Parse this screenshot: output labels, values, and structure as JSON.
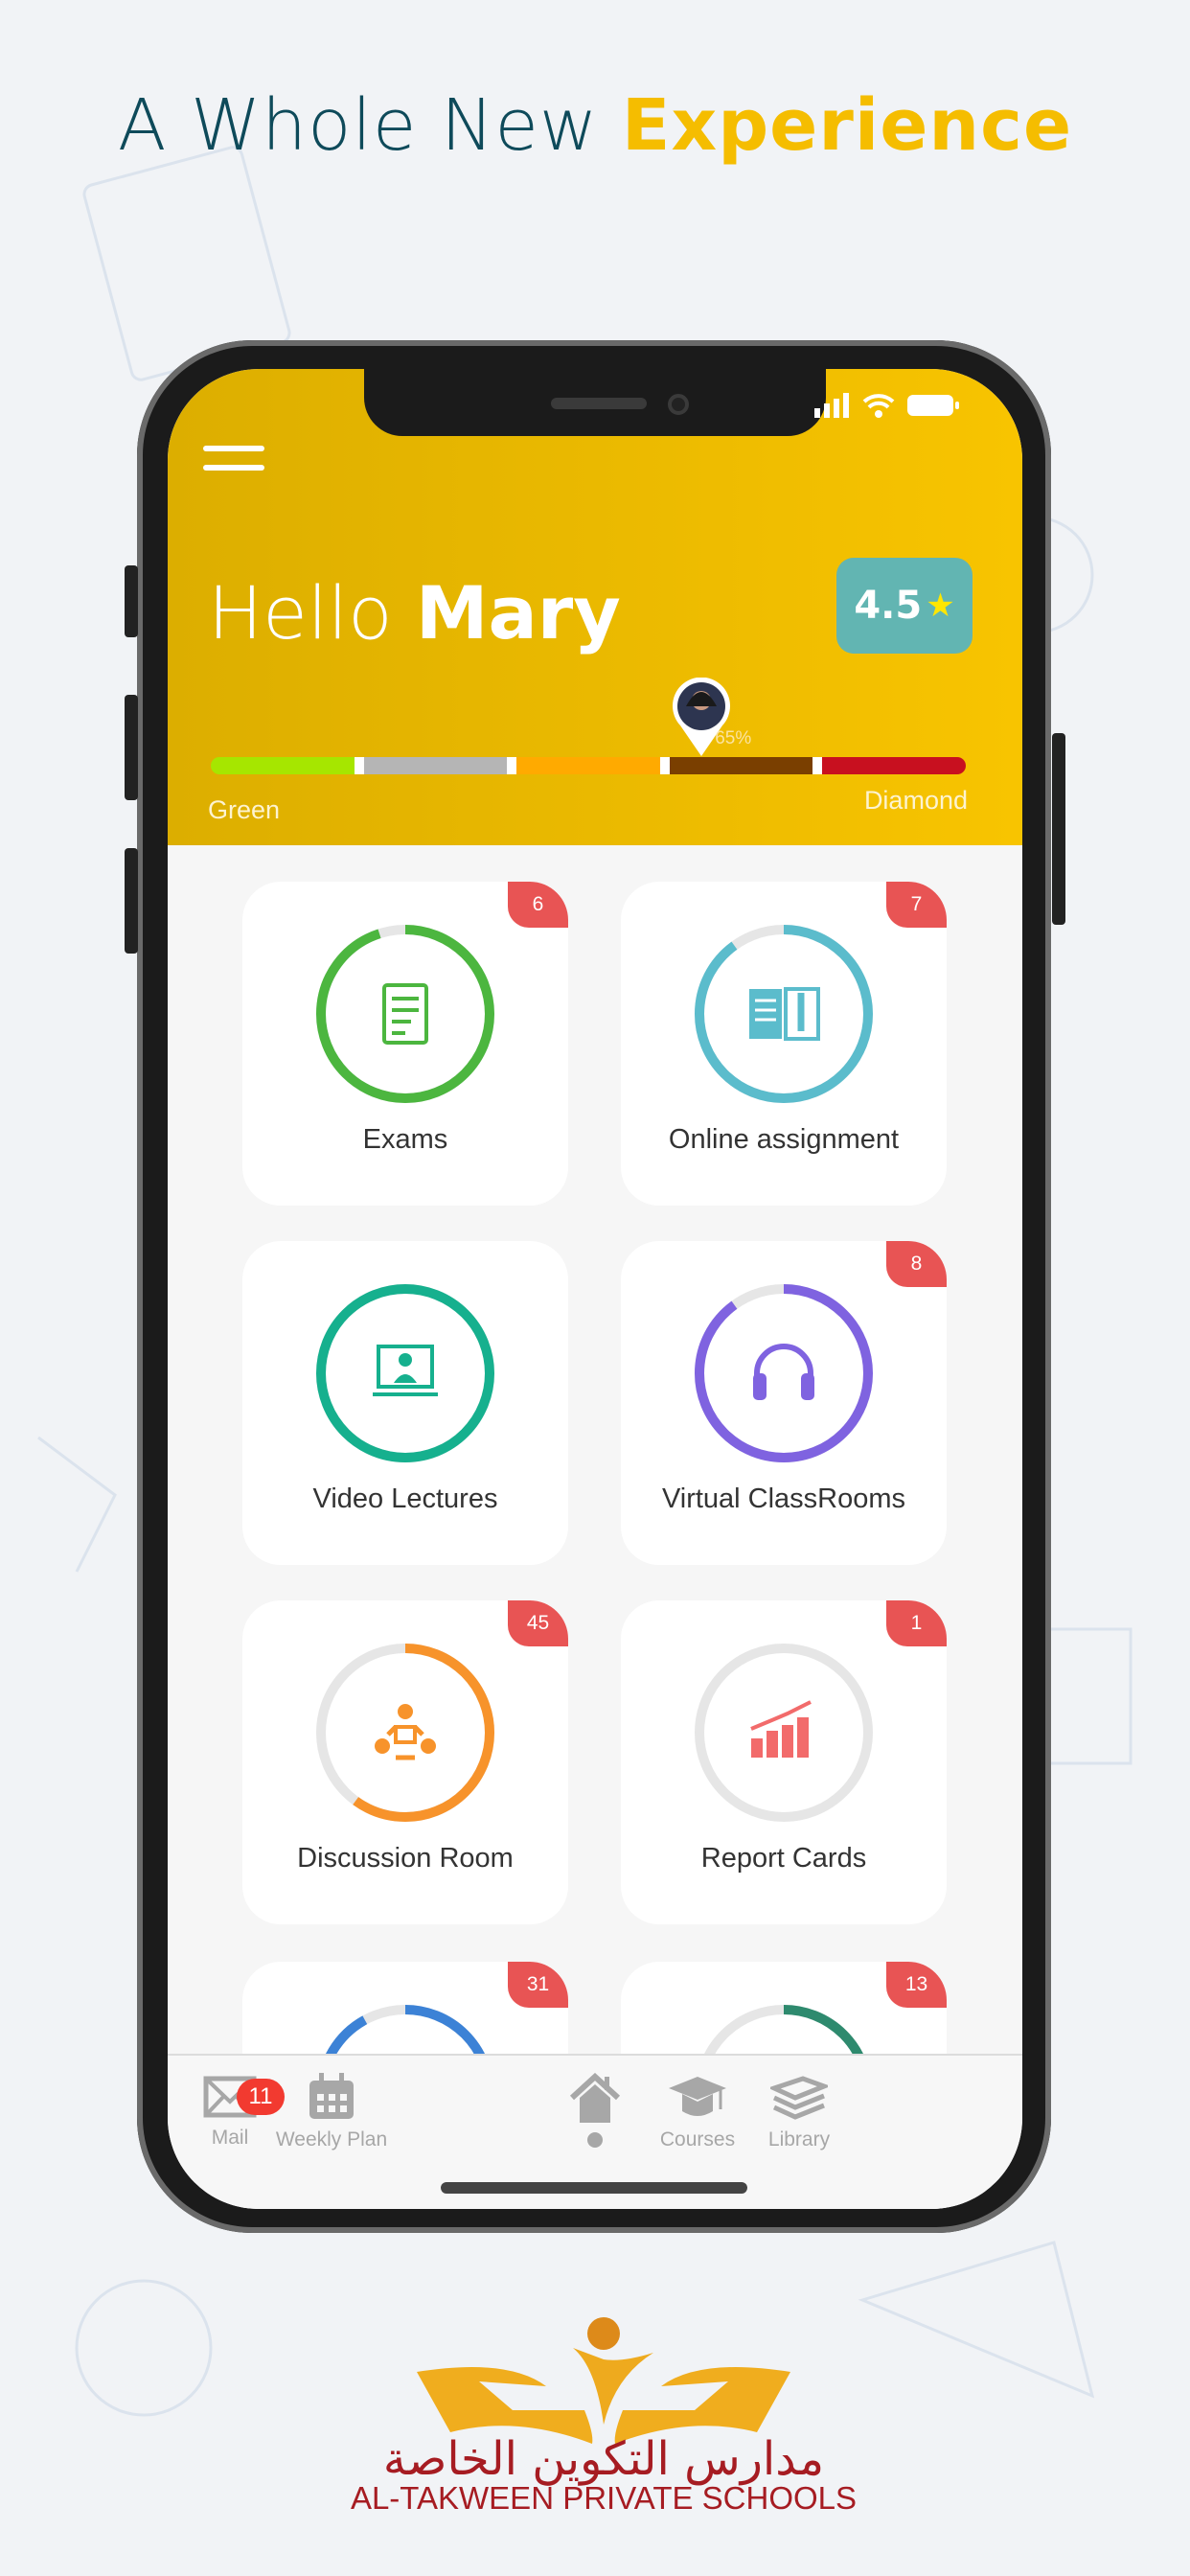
{
  "headline": {
    "part1": "A Whole New",
    "part2": "Experience"
  },
  "header": {
    "greeting": "Hello",
    "name": "Mary",
    "rating": "4.5",
    "rating_icon": "star-icon",
    "level_progress_percent": 65,
    "progress_label": "65%",
    "level_start": "Green",
    "level_end": "Diamond",
    "level_colors": [
      "#a6e600",
      "#b5b5b5",
      "#ffaa00",
      "#7a3f00",
      "#c8101f"
    ]
  },
  "cards": [
    {
      "label": "Exams",
      "badge": "6",
      "progress": 0.95,
      "color": "#4cb63f",
      "icon": "exam-checklist-icon"
    },
    {
      "label": "Online assignment",
      "badge": "7",
      "progress": 0.9,
      "color": "#5bbccc",
      "icon": "book-pencil-icon"
    },
    {
      "label": "Video Lectures",
      "badge": "",
      "progress": 1.0,
      "color": "#16b08e",
      "icon": "video-lecture-icon"
    },
    {
      "label": "Virtual ClassRooms",
      "badge": "8",
      "progress": 0.9,
      "color": "#7f63e0",
      "icon": "headphones-icon"
    },
    {
      "label": "Discussion Room",
      "badge": "45",
      "progress": 0.6,
      "color": "#f7932b",
      "icon": "discussion-group-icon"
    },
    {
      "label": "Report Cards",
      "badge": "1",
      "progress": 0.0,
      "color": "#f26b6b",
      "icon": "chart-growth-icon"
    },
    {
      "label": "",
      "badge": "31",
      "progress": 0.92,
      "color": "#3c82d6",
      "icon": ""
    },
    {
      "label": "",
      "badge": "13",
      "progress": 0.4,
      "color": "#2e8a6e",
      "icon": ""
    }
  ],
  "tabbar": {
    "items": [
      {
        "label": "Mail",
        "icon": "mail-icon",
        "badge": "11"
      },
      {
        "label": "Weekly Plan",
        "icon": "calendar-icon"
      },
      {
        "label": "",
        "icon": "home-icon",
        "active": true
      },
      {
        "label": "Courses",
        "icon": "graduation-cap-icon"
      },
      {
        "label": "Library",
        "icon": "books-icon"
      }
    ]
  },
  "logo": {
    "arabic": "مدارس التكوين الخاصة",
    "english": "AL-TAKWEEN PRIVATE SCHOOLS"
  }
}
